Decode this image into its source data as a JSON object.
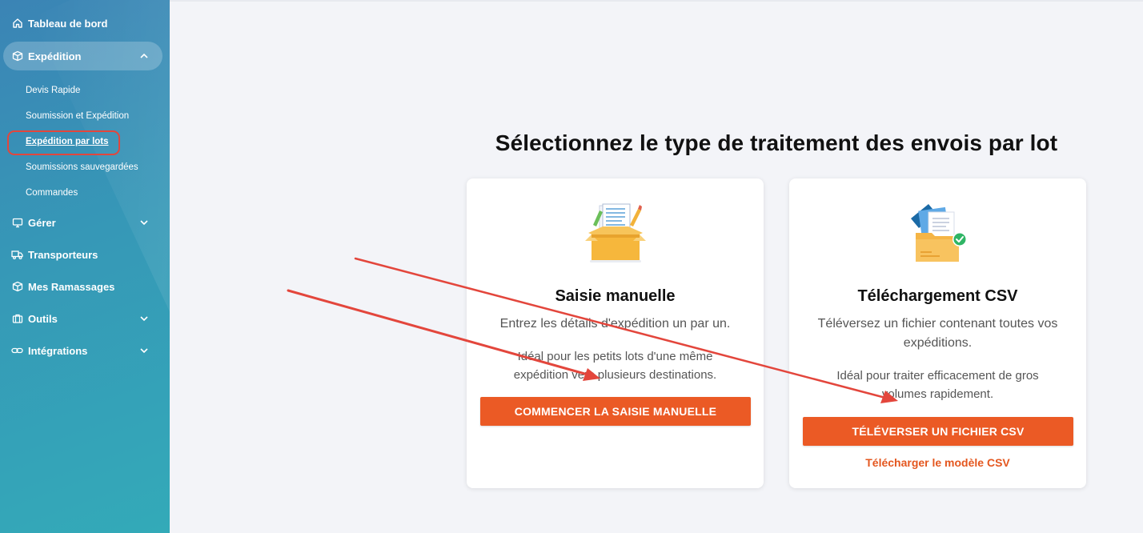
{
  "sidebar": {
    "items": [
      {
        "label": "Tableau de bord",
        "icon": "home-icon"
      },
      {
        "label": "Expédition",
        "icon": "box-icon",
        "expanded": true
      },
      {
        "label": "Gérer",
        "icon": "monitor-icon"
      },
      {
        "label": "Transporteurs",
        "icon": "truck-icon"
      },
      {
        "label": "Mes Ramassages",
        "icon": "package-icon"
      },
      {
        "label": "Outils",
        "icon": "toolbox-icon"
      },
      {
        "label": "Intégrations",
        "icon": "link-icon"
      }
    ],
    "sub_items": [
      {
        "label": "Devis Rapide"
      },
      {
        "label": "Soumission et Expédition"
      },
      {
        "label": "Expédition par lots",
        "current": true
      },
      {
        "label": "Soumissions sauvegardées"
      },
      {
        "label": "Commandes"
      }
    ]
  },
  "main": {
    "title": "Sélectionnez le type de traitement des envois par lot",
    "cards": {
      "manual": {
        "title": "Saisie manuelle",
        "description": "Entrez les détails d'expédition un par un.",
        "note": "Idéal pour les petits lots d'une même expédition vers plusieurs destinations.",
        "button": "COMMENCER LA SAISIE MANUELLE"
      },
      "csv": {
        "title": "Téléchargement CSV",
        "description": "Téléversez un fichier contenant toutes vos expéditions.",
        "note": "Idéal pour traiter efficacement de gros volumes rapidement.",
        "button": "TÉLÉVERSER UN FICHIER CSV",
        "link": "Télécharger le modèle CSV"
      }
    }
  },
  "colors": {
    "accent": "#eb5a25",
    "annotation": "#e3463c",
    "sidebar_top": "#3b84b5",
    "sidebar_bottom": "#33aab8"
  }
}
